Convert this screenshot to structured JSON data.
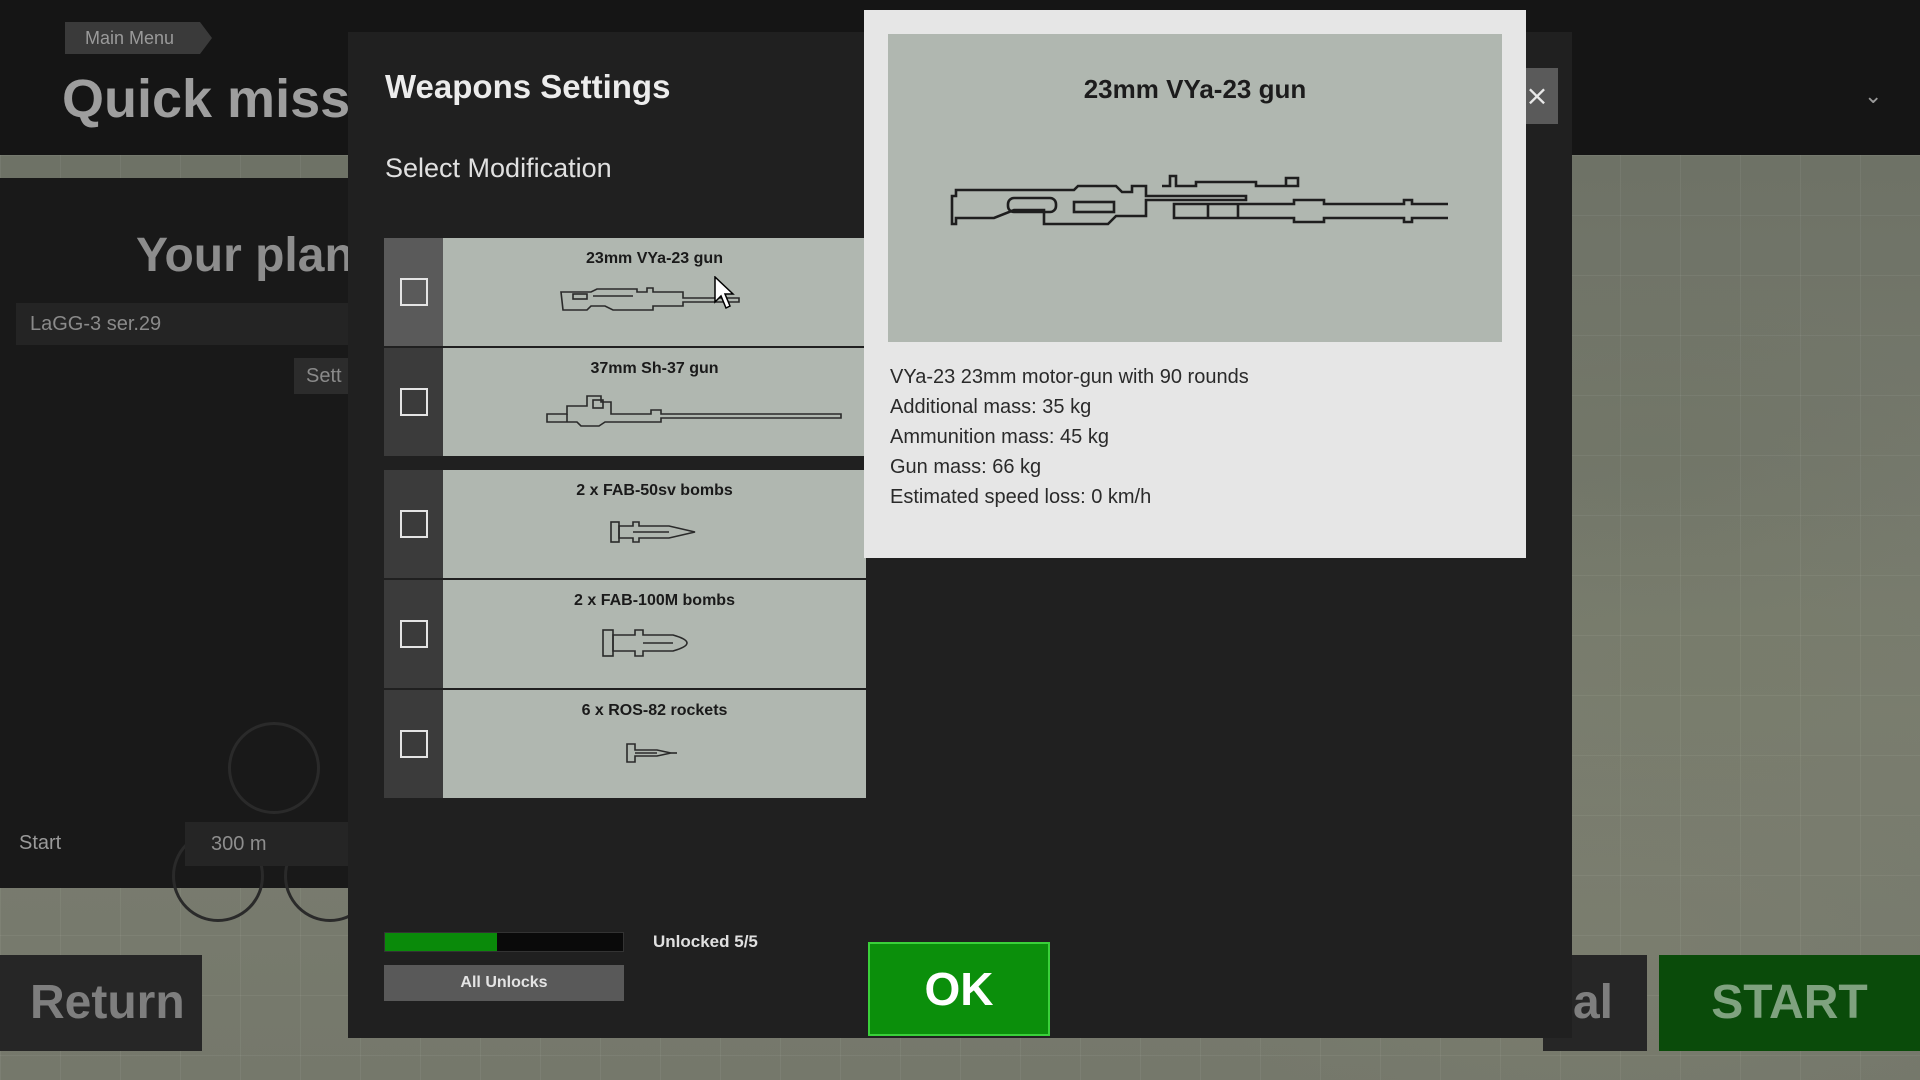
{
  "background": {
    "breadcrumb": "Main Menu",
    "page_title": "Quick missio",
    "plane_heading": "Your plane",
    "plane_select_value": "LaGG-3 ser.29",
    "settings_button": "Sett",
    "start_label": "Start",
    "altitude_value": "300 m",
    "return_button": "Return",
    "partial_button": "al",
    "start_button": "START"
  },
  "modal": {
    "title": "Weapons Settings",
    "subtitle": "Select Modification",
    "close_icon": "×",
    "modifications": [
      {
        "name": "23mm VYa-23 gun",
        "icon": "gun-small-icon",
        "selected": true
      },
      {
        "name": "37mm Sh-37 gun",
        "icon": "gun-large-icon",
        "selected": false
      },
      {
        "name": "2 x FAB-50sv bombs",
        "icon": "bomb-small-icon",
        "selected": false
      },
      {
        "name": "2 x FAB-100M bombs",
        "icon": "bomb-large-icon",
        "selected": false
      },
      {
        "name": "6 x ROS-82 rockets",
        "icon": "rocket-icon",
        "selected": false
      }
    ],
    "detail": {
      "title": "23mm VYa-23 gun",
      "lines": [
        "VYa-23 23mm motor-gun with 90 rounds",
        "Additional mass: 35 kg",
        "Ammunition mass: 45 kg",
        "Gun mass: 66 kg",
        "Estimated speed loss: 0 km/h"
      ]
    },
    "progress_fraction": 0.47,
    "unlocked_label": "Unlocked 5/5",
    "all_unlocks_button": "All Unlocks",
    "ok_button": "OK"
  },
  "colors": {
    "accent_green": "#0b8f0b",
    "card_bg": "#b0b7b0",
    "modal_bg": "#202020"
  }
}
